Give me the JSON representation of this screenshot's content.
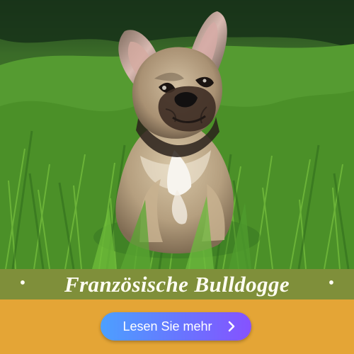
{
  "banner": {
    "title": "Französische Bulldogge",
    "bullet_left": "•",
    "bullet_right": "•",
    "button_label": "Lesen Sie mehr",
    "button_icon": "chevron-right-icon",
    "colors": {
      "title_band": "#7f8f3a",
      "cta_background": "#e4a536",
      "button_start": "#4ca0ff",
      "button_end": "#8652ff"
    }
  }
}
